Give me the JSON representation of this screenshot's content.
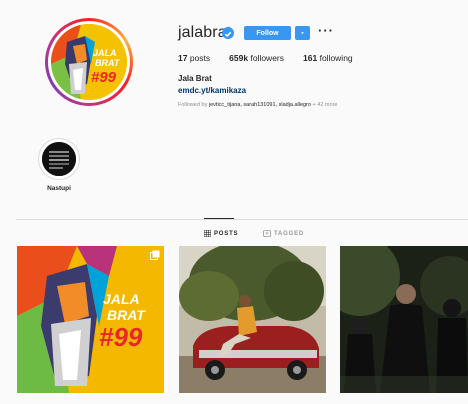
{
  "profile": {
    "username": "jalabrat",
    "follow_label": "Follow",
    "more_label": "···",
    "full_name": "Jala Brat",
    "link": "emdc.yt/kamikaza",
    "followed_by_prefix": "Followed by",
    "followed_by_names": "jevticc_tijana, sarah131091, sladja.allegro",
    "followed_by_more": "+ 42 more"
  },
  "stats": {
    "posts_count": "17",
    "posts_label": "posts",
    "followers_count": "659k",
    "followers_label": "followers",
    "following_count": "161",
    "following_label": "following"
  },
  "avatar_art_text": {
    "line1": "JALA",
    "line2": "BRAT",
    "line3": "#99"
  },
  "highlight": {
    "label": "Nastupi"
  },
  "tabs": [
    {
      "label": "POSTS",
      "icon": "grid-icon",
      "active": true
    },
    {
      "label": "TAGGED",
      "icon": "tag-icon",
      "active": false
    }
  ],
  "posts": [
    {
      "art_text": [
        "JALA",
        "BRAT",
        "#99"
      ],
      "icon": "multiple-posts-icon"
    },
    {
      "art_text": []
    },
    {
      "art_text": []
    }
  ],
  "colors": {
    "accent": "#3897f0",
    "link": "#003569",
    "muted": "#8e8e8e",
    "post1_bg": "#f5b800"
  }
}
